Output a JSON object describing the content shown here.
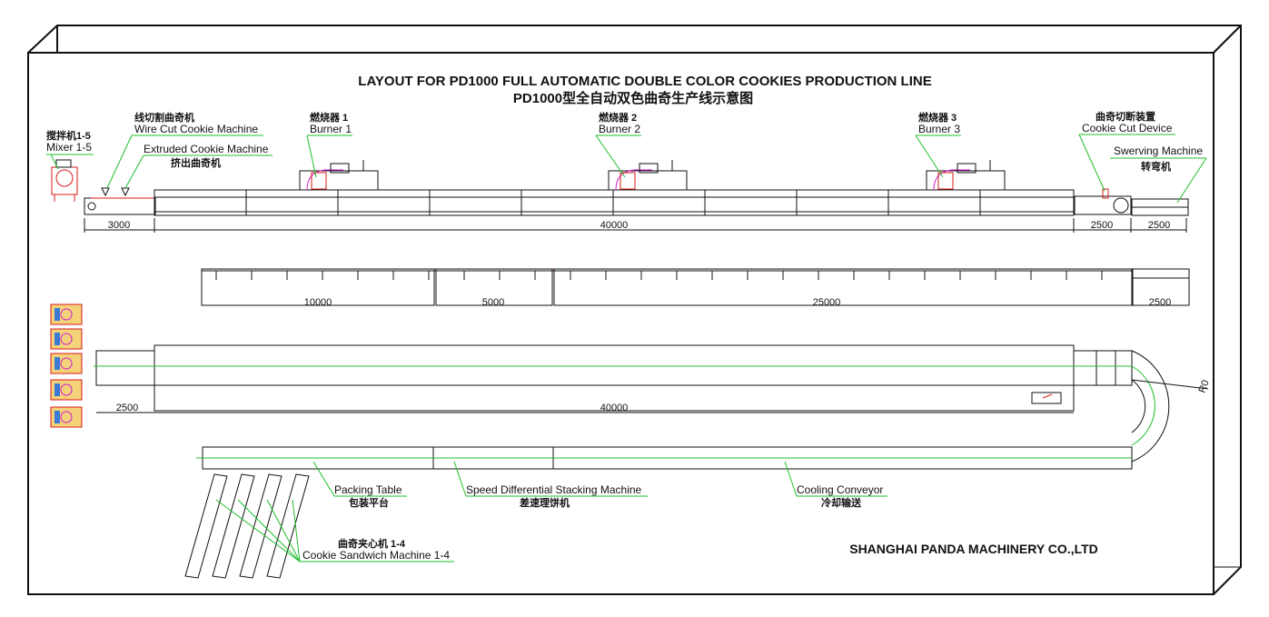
{
  "title": {
    "en": "LAYOUT FOR PD1000 FULL AUTOMATIC DOUBLE COLOR COOKIES PRODUCTION LINE",
    "cn": "PD1000型全自动双色曲奇生产线示意图"
  },
  "labels": {
    "mixer": {
      "cn": "搅拌机1-5",
      "en": "Mixer 1-5"
    },
    "wire_cut": {
      "cn": "线切割曲奇机",
      "en": "Wire Cut Cookie Machine"
    },
    "extruded": {
      "en": "Extruded Cookie Machine",
      "cn": "挤出曲奇机"
    },
    "burner1": {
      "cn": "燃烧器 1",
      "en": "Burner 1"
    },
    "burner2": {
      "cn": "燃烧器 2",
      "en": "Burner 2"
    },
    "burner3": {
      "cn": "燃烧器 3",
      "en": "Burner 3"
    },
    "cut_device": {
      "cn": "曲奇切断装置",
      "en": "Cookie Cut Device"
    },
    "swerving": {
      "en": "Swerving Machine",
      "cn": "转弯机"
    },
    "packing": {
      "en": "Packing Table",
      "cn": "包装平台"
    },
    "stacking": {
      "en": "Speed Differential Stacking Machine",
      "cn": "差速理饼机"
    },
    "cooling": {
      "en": "Cooling Conveyor",
      "cn": "冷却输送"
    },
    "sandwich": {
      "cn": "曲奇夹心机 1-4",
      "en": "Cookie Sandwich Machine 1-4"
    }
  },
  "dimensions": {
    "row1": [
      "3000",
      "40000",
      "2500",
      "2500"
    ],
    "row2": [
      "10000",
      "5000",
      "25000",
      "2500"
    ],
    "row3": [
      "2500",
      "40000"
    ],
    "radius": "R0"
  },
  "company": "SHANGHAI PANDA MACHINERY CO.,LTD",
  "colors": {
    "leader": "#1fbf2a",
    "burner": "#d21ad2",
    "accent": "#d81b1b",
    "line": "#111111"
  }
}
